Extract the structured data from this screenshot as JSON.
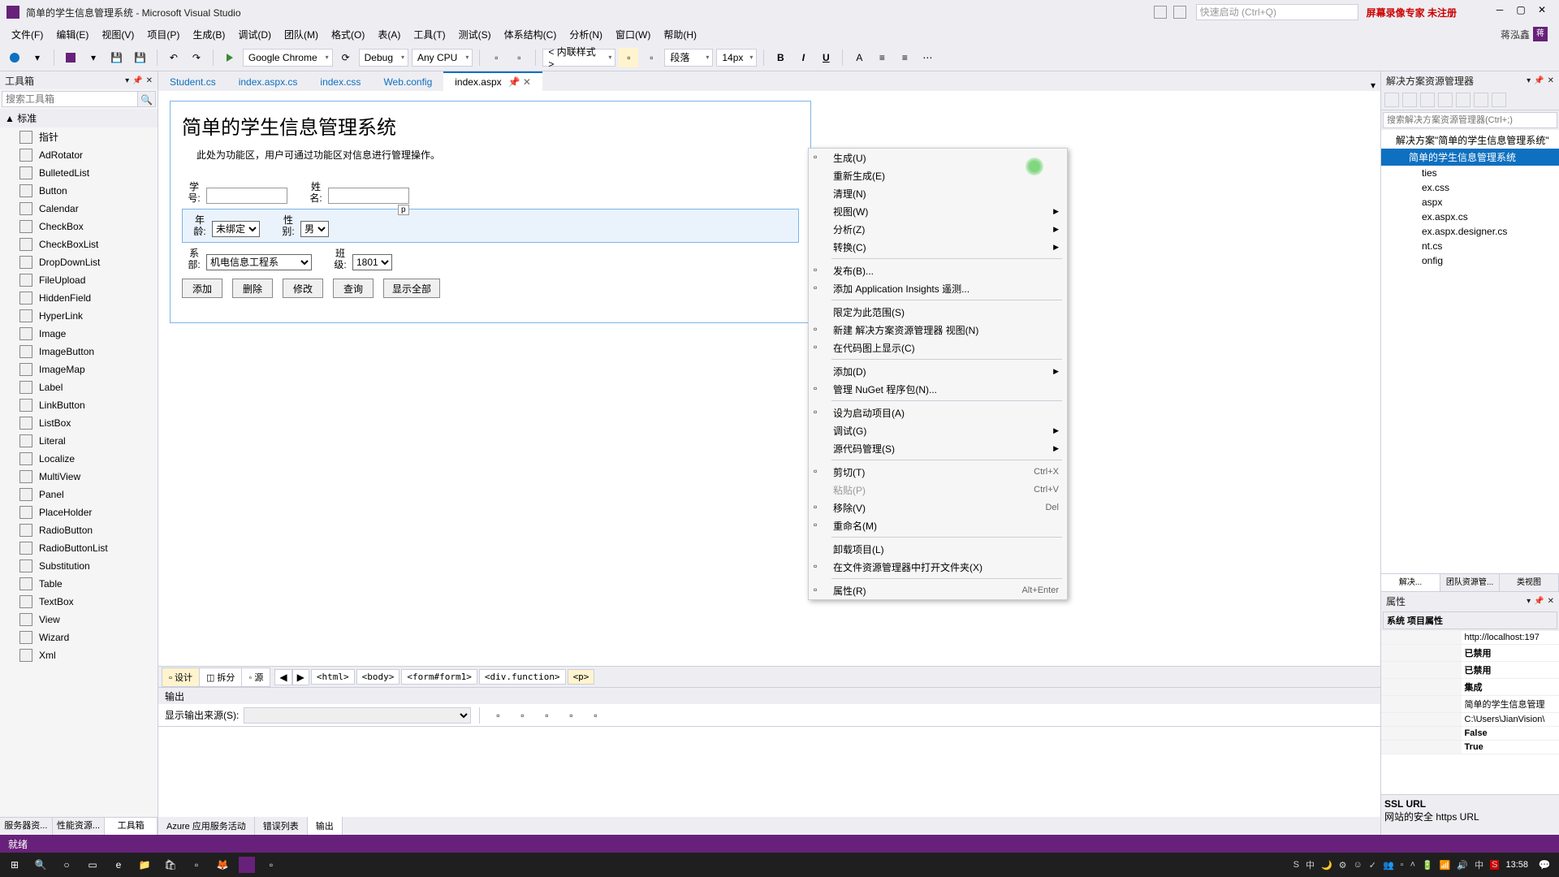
{
  "title": "简单的学生信息管理系统 - Microsoft Visual Studio",
  "quicklaunch": "快速启动 (Ctrl+Q)",
  "watermark": "屏幕录像专家 未注册",
  "username": "蒋泓鑫",
  "menu": [
    "文件(F)",
    "编辑(E)",
    "视图(V)",
    "项目(P)",
    "生成(B)",
    "调试(D)",
    "团队(M)",
    "格式(O)",
    "表(A)",
    "工具(T)",
    "测试(S)",
    "体系结构(C)",
    "分析(N)",
    "窗口(W)",
    "帮助(H)"
  ],
  "toolbar": {
    "browser": "Google Chrome",
    "config": "Debug",
    "platform": "Any CPU",
    "style_combo": "< 内联样式 >",
    "block_combo": "段落",
    "size_combo": "14px"
  },
  "toolbox": {
    "title": "工具箱",
    "search": "搜索工具箱",
    "group": "▲ 标准",
    "items": [
      "指针",
      "AdRotator",
      "BulletedList",
      "Button",
      "Calendar",
      "CheckBox",
      "CheckBoxList",
      "DropDownList",
      "FileUpload",
      "HiddenField",
      "HyperLink",
      "Image",
      "ImageButton",
      "ImageMap",
      "Label",
      "LinkButton",
      "ListBox",
      "Literal",
      "Localize",
      "MultiView",
      "Panel",
      "PlaceHolder",
      "RadioButton",
      "RadioButtonList",
      "Substitution",
      "Table",
      "TextBox",
      "View",
      "Wizard",
      "Xml"
    ],
    "tabs": [
      "服务器资...",
      "性能资源...",
      "工具箱"
    ]
  },
  "tabs": [
    "Student.cs",
    "index.aspx.cs",
    "index.css",
    "Web.config",
    "index.aspx"
  ],
  "page": {
    "title": "简单的学生信息管理系统",
    "desc": "此处为功能区，用户可通过功能区对信息进行管理操作。",
    "labels": {
      "id1": "学",
      "id2": "号:",
      "name1": "姓",
      "name2": "名:",
      "age1": "年",
      "age2": "龄:",
      "sex1": "性",
      "sex2": "别:",
      "dept1": "系",
      "dept2": "部:",
      "class1": "班",
      "class2": "级:"
    },
    "age_opt": "未绑定",
    "sex_opt": "男",
    "dept_opt": "机电信息工程系",
    "class_opt": "1801",
    "buttons": {
      "add": "添加",
      "del": "删除",
      "mod": "修改",
      "qry": "查询",
      "all": "显示全部"
    }
  },
  "view_tabs": {
    "design": "▫ 设计",
    "split": "◫ 拆分",
    "source": "◦ 源"
  },
  "breadcrumbs": [
    "<html>",
    "<body>",
    "<form#form1>",
    "<div.function>",
    "<p>"
  ],
  "output": {
    "title": "输出",
    "src_label": "显示输出来源(S):",
    "tabs": [
      "Azure 应用服务活动",
      "错误列表",
      "输出"
    ]
  },
  "solution": {
    "title": "解决方案资源管理器",
    "search": "搜索解决方案资源管理器(Ctrl+;)",
    "root": "解决方案\"简单的学生信息管理系统\"",
    "project": "简单的学生信息管理系统",
    "files": [
      "ties",
      "ex.css",
      "aspx",
      "ex.aspx.cs",
      "ex.aspx.designer.cs",
      "nt.cs",
      "onfig"
    ],
    "tabs": [
      "解决...",
      "团队资源管...",
      "类视图"
    ]
  },
  "props": {
    "title": "属性",
    "obj": "系统 项目属性",
    "rows": [
      {
        "n": "",
        "v": "http://localhost:197"
      },
      {
        "n": "",
        "v": "已禁用",
        "b": true
      },
      {
        "n": "",
        "v": "已禁用",
        "b": true
      },
      {
        "n": "",
        "v": "集成",
        "b": true
      },
      {
        "n": "",
        "v": "简单的学生信息管理"
      },
      {
        "n": "",
        "v": "C:\\Users\\JianVision\\"
      },
      {
        "n": "",
        "v": "False",
        "b": true
      },
      {
        "n": "",
        "v": "True",
        "b": true
      }
    ],
    "desc_title": "SSL URL",
    "desc_text": "网站的安全 https URL"
  },
  "context": [
    {
      "t": "生成(U)",
      "icon": 1
    },
    {
      "t": "重新生成(E)"
    },
    {
      "t": "清理(N)"
    },
    {
      "t": "视图(W)",
      "sub": 1
    },
    {
      "t": "分析(Z)",
      "sub": 1
    },
    {
      "t": "转换(C)",
      "sub": 1
    },
    {
      "sep": 1
    },
    {
      "t": "发布(B)...",
      "icon": 1
    },
    {
      "t": "添加 Application Insights 遥测...",
      "icon": 1
    },
    {
      "sep": 1
    },
    {
      "t": "限定为此范围(S)"
    },
    {
      "t": "新建 解决方案资源管理器 视图(N)",
      "icon": 1
    },
    {
      "t": "在代码图上显示(C)",
      "icon": 1
    },
    {
      "sep": 1
    },
    {
      "t": "添加(D)",
      "sub": 1
    },
    {
      "t": "管理 NuGet 程序包(N)...",
      "icon": 1
    },
    {
      "sep": 1
    },
    {
      "t": "设为启动项目(A)",
      "icon": 1
    },
    {
      "t": "调试(G)",
      "sub": 1
    },
    {
      "t": "源代码管理(S)",
      "sub": 1
    },
    {
      "sep": 1
    },
    {
      "t": "剪切(T)",
      "icon": 1,
      "s": "Ctrl+X"
    },
    {
      "t": "粘贴(P)",
      "s": "Ctrl+V",
      "dis": 1
    },
    {
      "t": "移除(V)",
      "icon": 1,
      "s": "Del"
    },
    {
      "t": "重命名(M)",
      "icon": 1
    },
    {
      "sep": 1
    },
    {
      "t": "卸载项目(L)"
    },
    {
      "t": "在文件资源管理器中打开文件夹(X)",
      "icon": 1
    },
    {
      "sep": 1
    },
    {
      "t": "属性(R)",
      "icon": 1,
      "s": "Alt+Enter"
    }
  ],
  "status": "就绪",
  "clock": "13:58"
}
